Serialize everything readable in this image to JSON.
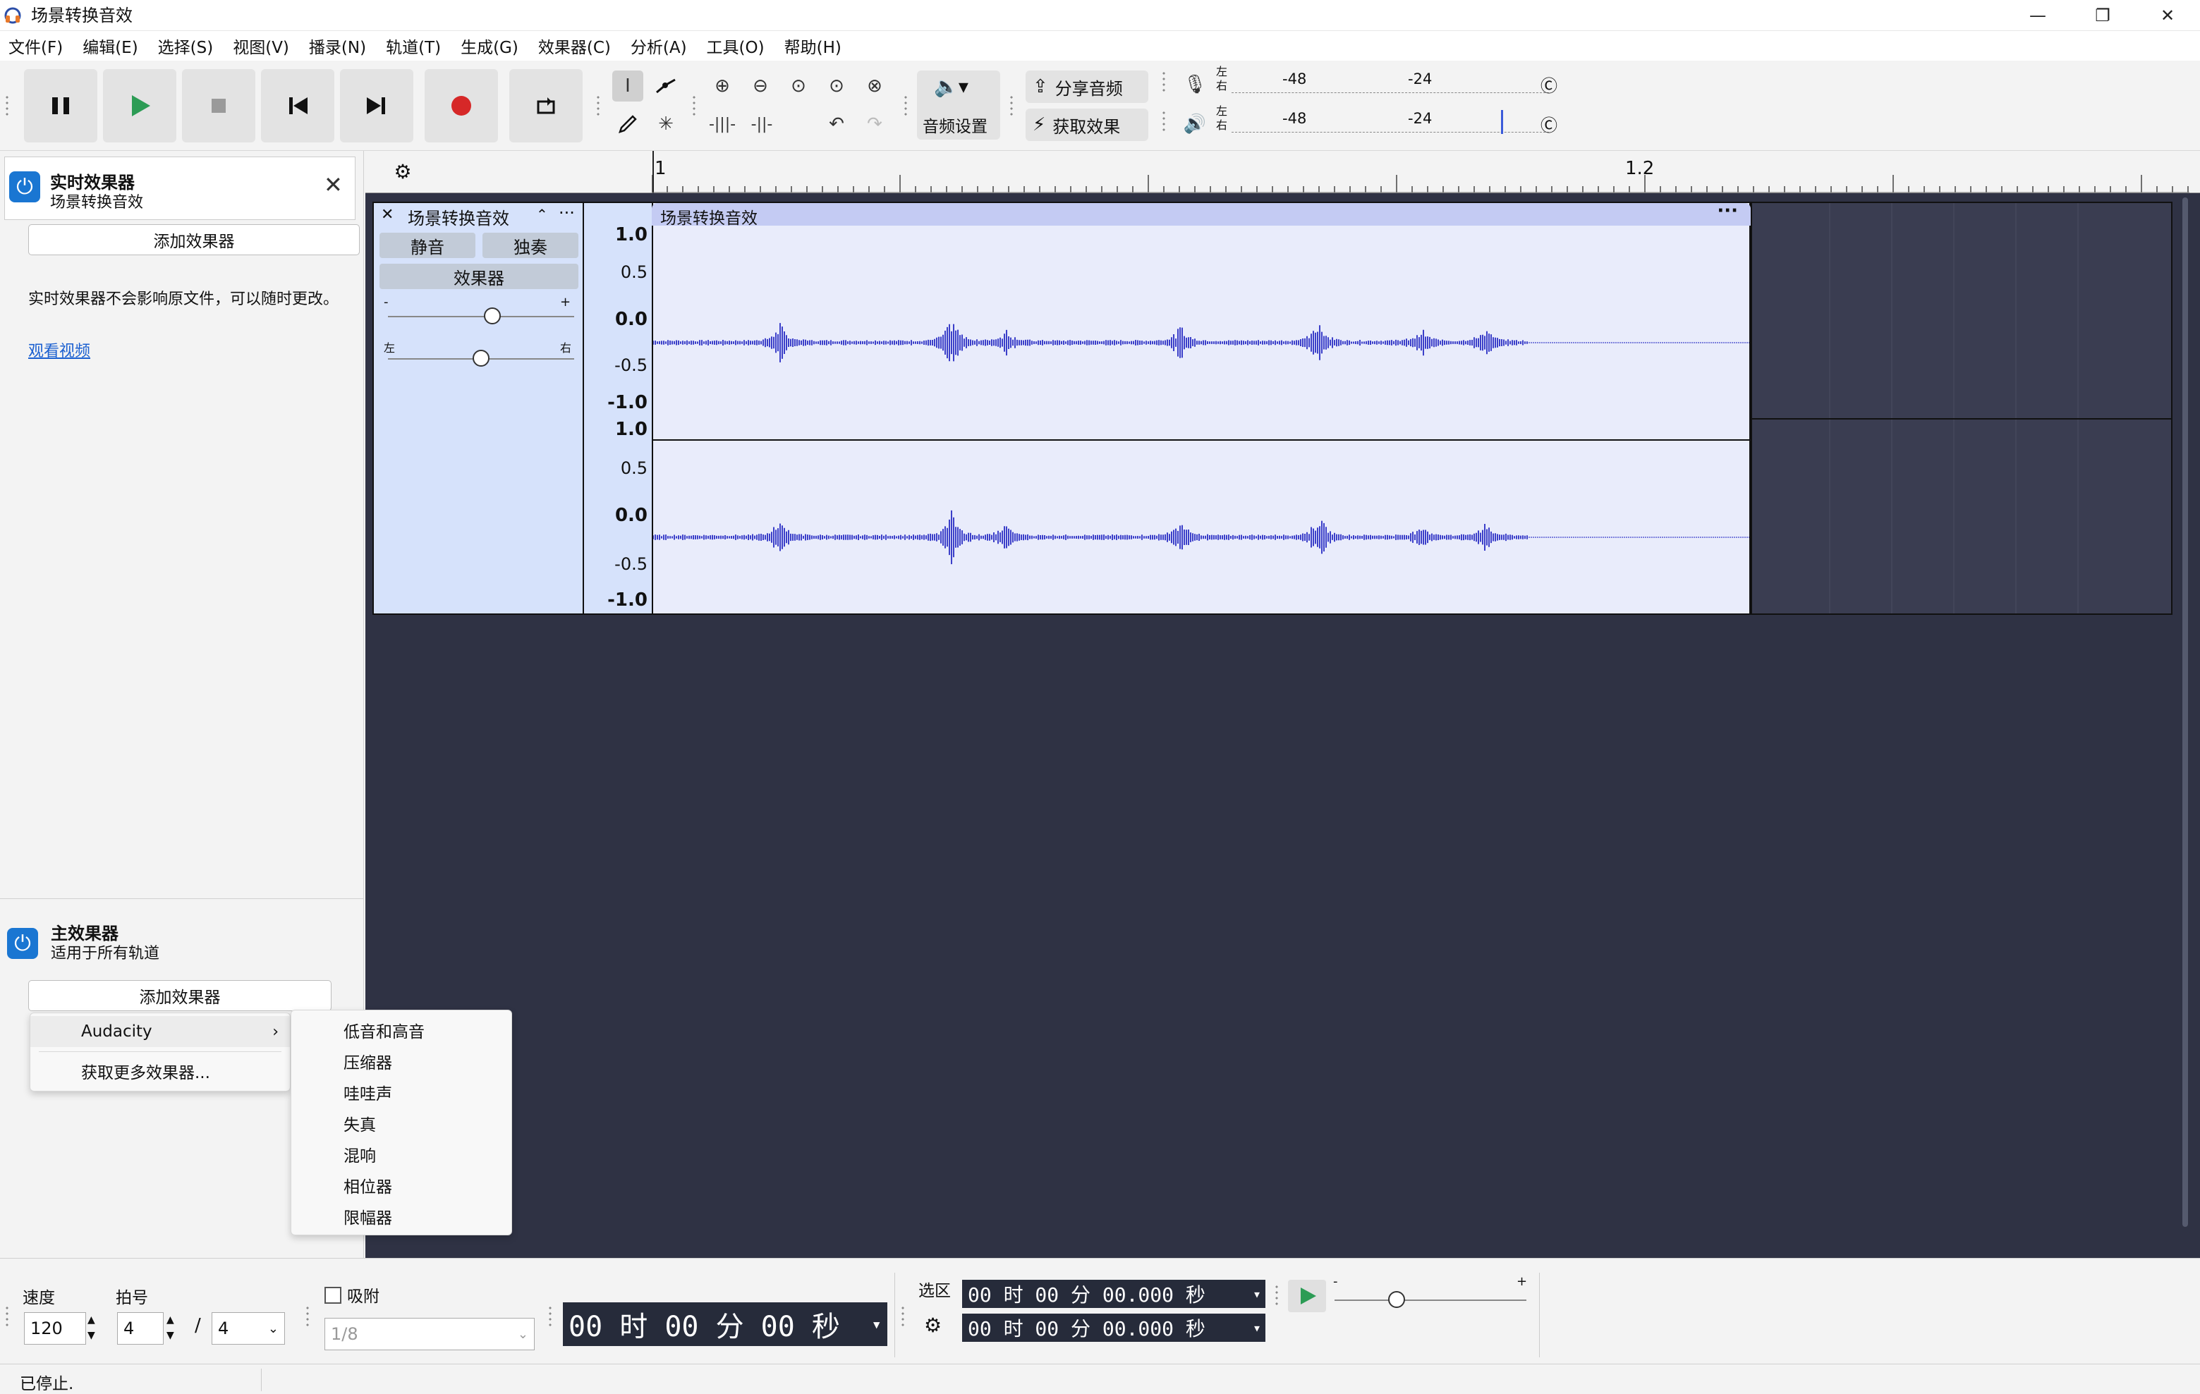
{
  "window": {
    "title": "场景转换音效",
    "minimize": "—",
    "maximize": "❐",
    "close": "✕"
  },
  "menu": [
    "文件(F)",
    "编辑(E)",
    "选择(S)",
    "视图(V)",
    "播录(N)",
    "轨道(T)",
    "生成(G)",
    "效果器(C)",
    "分析(A)",
    "工具(O)",
    "帮助(H)"
  ],
  "toolbar": {
    "audio_setup": "音频设置",
    "share_audio": "分享音频",
    "get_effects": "获取效果",
    "meter_ticks": [
      "-48",
      "-24"
    ],
    "meter_channels": [
      "左",
      "右"
    ]
  },
  "realtime_effects": {
    "title": "实时效果器",
    "subtitle": "场景转换音效",
    "add_button": "添加效果器",
    "note": "实时效果器不会影响原文件，可以随时更改。",
    "link": "观看视频"
  },
  "master_effects": {
    "title": "主效果器",
    "subtitle": "适用于所有轨道",
    "add_button": "添加效果器"
  },
  "add_effect_menu": {
    "items": [
      "Audacity",
      "获取更多效果器..."
    ],
    "submenu": [
      "低音和高音",
      "压缩器",
      "哇哇声",
      "失真",
      "混响",
      "相位器",
      "限幅器"
    ]
  },
  "ruler": {
    "labels": [
      "1",
      "1.2"
    ]
  },
  "track": {
    "name": "场景转换音效",
    "mute": "静音",
    "solo": "独奏",
    "effects": "效果器",
    "gain_minus": "-",
    "gain_plus": "+",
    "pan_left": "左",
    "pan_right": "右",
    "clip_name": "场景转换音效",
    "y_ticks": [
      "1.0",
      "0.5",
      "0.0",
      "-0.5",
      "-1.0"
    ],
    "waveform_color": "#3b3fc9"
  },
  "bottom": {
    "tempo_label": "速度",
    "tempo": "120",
    "meter_label": "拍号",
    "meter_num": "4",
    "slash": "/",
    "meter_den": "4",
    "snap_label": "吸附",
    "snap_value": "1/8",
    "time_display": "00 时 00 分 00 秒",
    "selection_label": "选区",
    "sel_start": "00 时 00 分 00.000 秒",
    "sel_end": "00 时 00 分 00.000 秒",
    "speed_minus": "-",
    "speed_plus": "+"
  },
  "status": {
    "text": "已停止."
  },
  "colors": {
    "accent": "#1a76d2",
    "record": "#d62828",
    "play": "#2c9c55"
  }
}
